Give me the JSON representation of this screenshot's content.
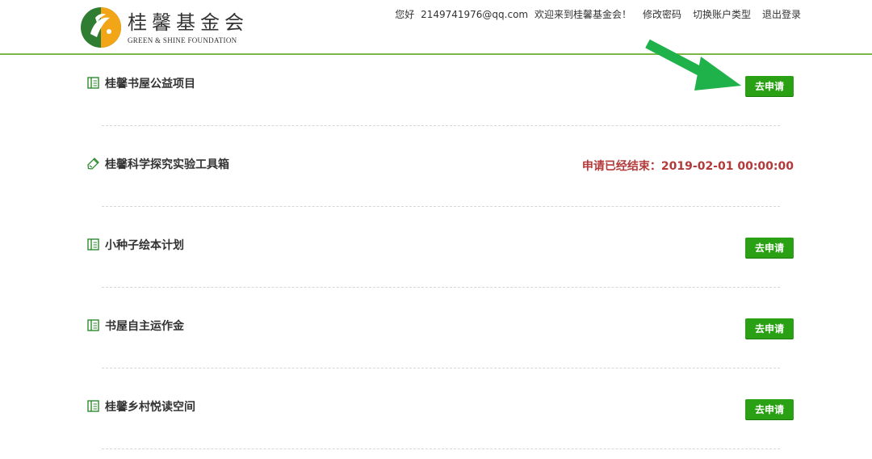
{
  "brand": {
    "name_cn": "桂馨基金会",
    "name_en": "GREEN & SHINE FOUNDATION"
  },
  "topnav": {
    "greeting": "您好",
    "email": "2149741976@qq.com",
    "welcome": "欢迎来到桂馨基金会！",
    "change_password": "修改密码",
    "switch_account_type": "切换账户类型",
    "logout": "退出登录"
  },
  "projects": [
    {
      "title": "桂馨书屋公益项目",
      "icon": "book-icon",
      "action": "去申请"
    },
    {
      "title": "桂馨科学探究实验工具箱",
      "icon": "flask-icon",
      "status": "申请已经结束：2019-02-01 00:00:00"
    },
    {
      "title": "小种子绘本计划",
      "icon": "book-icon",
      "action": "去申请"
    },
    {
      "title": "书屋自主运作金",
      "icon": "book-icon",
      "action": "去申请"
    },
    {
      "title": "桂馨乡村悦读空间",
      "icon": "book-icon",
      "action": "去申请"
    }
  ],
  "colors": {
    "accent_green": "#2aa015",
    "header_line": "#79b547",
    "ended_red": "#b33a3a",
    "arrow_green": "#1fb14a"
  }
}
